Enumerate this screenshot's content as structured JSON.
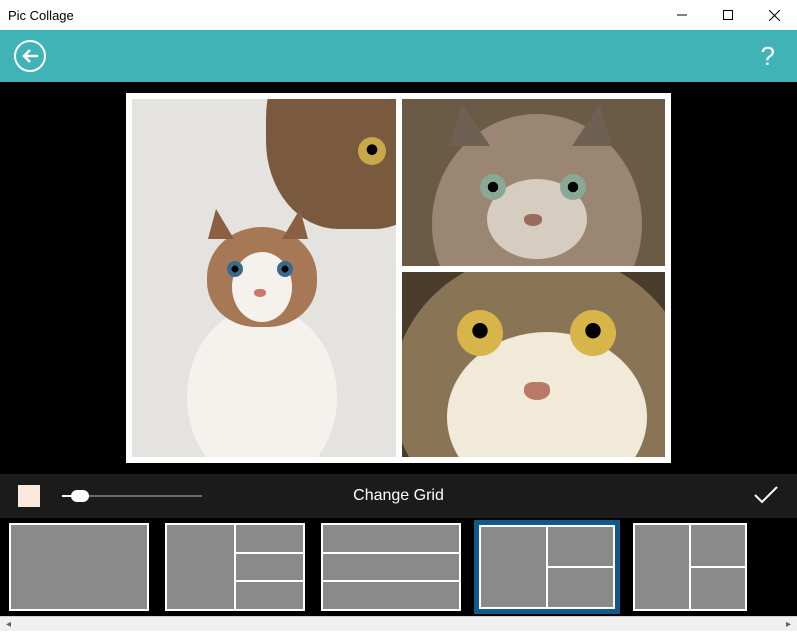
{
  "window": {
    "title": "Pic Collage"
  },
  "controls": {
    "label": "Change Grid",
    "swatch_color": "#fce9dd",
    "slider_percent": 13
  },
  "topbar": {
    "help_glyph": "?"
  },
  "grids": {
    "selected_index": 3,
    "items": [
      {
        "layout": "single"
      },
      {
        "layout": "left-plus-three"
      },
      {
        "layout": "three-rows"
      },
      {
        "layout": "left-plus-two"
      },
      {
        "layout": "two-col-right-split"
      }
    ]
  }
}
